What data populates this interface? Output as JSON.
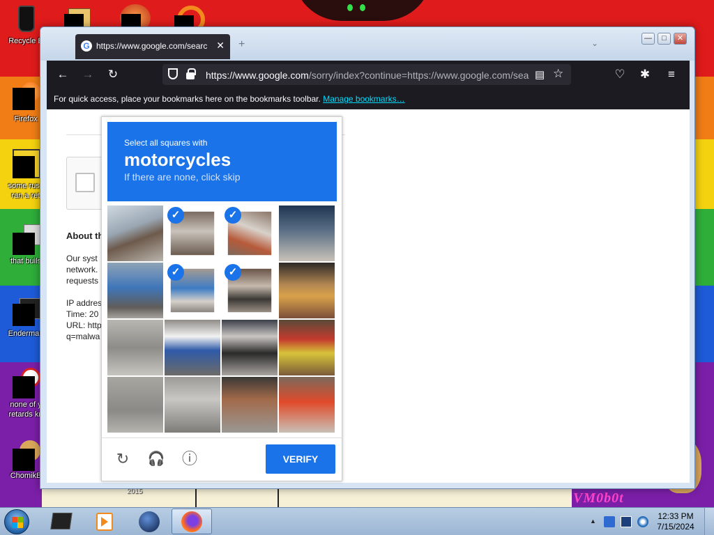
{
  "desktop": {
    "icons": [
      {
        "label": "Recycle B"
      },
      {
        "label": "Firefox"
      },
      {
        "label": "some russ",
        "label2": "ran a ret"
      },
      {
        "label": "that buils"
      },
      {
        "label": "Enderman"
      },
      {
        "label": "none of y",
        "label2": "retards kn"
      },
      {
        "label": "ChomikB"
      }
    ],
    "wallpaper_text": "VM0b0t",
    "wallpaper_year": "2015"
  },
  "browser": {
    "tab_title": "https://www.google.com/searc",
    "tab_close": "✕",
    "new_tab": "+",
    "tab_list": "⌄",
    "window_buttons": {
      "minimize": "—",
      "maximize": "□",
      "close": "✕"
    },
    "nav": {
      "back": "←",
      "forward": "→",
      "reload": "↻"
    },
    "url_domain": "https://www.google.com",
    "url_rest": "/sorry/index?continue=https://www.google.com/sea",
    "bookmarks_text": "For quick access, place your bookmarks here on the bookmarks toolbar.",
    "bookmarks_link": "Manage bookmarks…",
    "toolbar_icons": {
      "pocket": "♡",
      "extensions": "✱",
      "menu": "≡",
      "reader": "▤",
      "star": "☆"
    }
  },
  "sorry_page": {
    "about_heading": "About th",
    "lines": [
      "Our syst",
      "network.",
      "requests"
    ],
    "ip_label": "IP addres",
    "time_label": "Time: 20",
    "url_label": "URL: http",
    "url_cont": "q=malwa"
  },
  "captcha": {
    "instruction": "Select all squares with",
    "target": "motorcycles",
    "hint": "If there are none, click skip",
    "selected_tiles": [
      1,
      2,
      5,
      6
    ],
    "verify_label": "VERIFY",
    "icons": {
      "reload": "↻",
      "audio": "🎧",
      "info": "ⓘ"
    },
    "check": "✓"
  },
  "taskbar": {
    "clock_time": "12:33 PM",
    "clock_date": "7/15/2024",
    "tray_arrow": "▲"
  }
}
